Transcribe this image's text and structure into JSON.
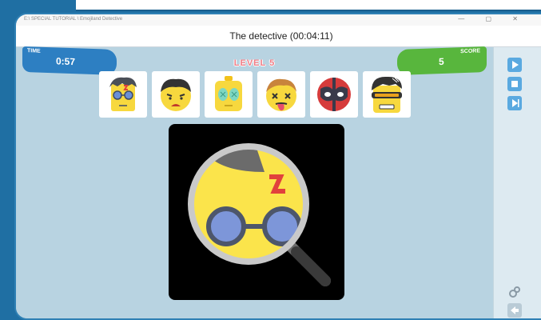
{
  "titlebar": {
    "caption": "E:\\ SPECIAL TUTORIAL \\ Emojiland Detective",
    "controls": "— ▢ ✕"
  },
  "header": {
    "title": "The detective (00:04:11)"
  },
  "hud": {
    "time_label": "TIME",
    "time_value": "0:57",
    "score_label": "SCORE",
    "score_value": "5",
    "level_text": "LEVEL 5"
  },
  "cards": [
    {
      "icon": "harry-potter-emoji-icon"
    },
    {
      "icon": "sad-boy-emoji-icon"
    },
    {
      "icon": "alien-robot-emoji-icon"
    },
    {
      "icon": "dizzy-tongue-emoji-icon"
    },
    {
      "icon": "deadpool-mask-icon"
    },
    {
      "icon": "cyclops-emoji-icon"
    }
  ],
  "stage": {
    "icon": "magnifier-harry-potter-icon"
  },
  "sidebar": {
    "buttons": [
      "play-icon",
      "stop-icon",
      "next-icon"
    ],
    "bottom_buttons": [
      "settings-icon",
      "back-arrow-icon"
    ]
  },
  "colors": {
    "time_pill": "#2d7fc2",
    "score_pill": "#58b63d",
    "level_text": "#f07d86",
    "board_bg": "#b8d3e1",
    "emoji_yellow": "#f7d83e"
  }
}
